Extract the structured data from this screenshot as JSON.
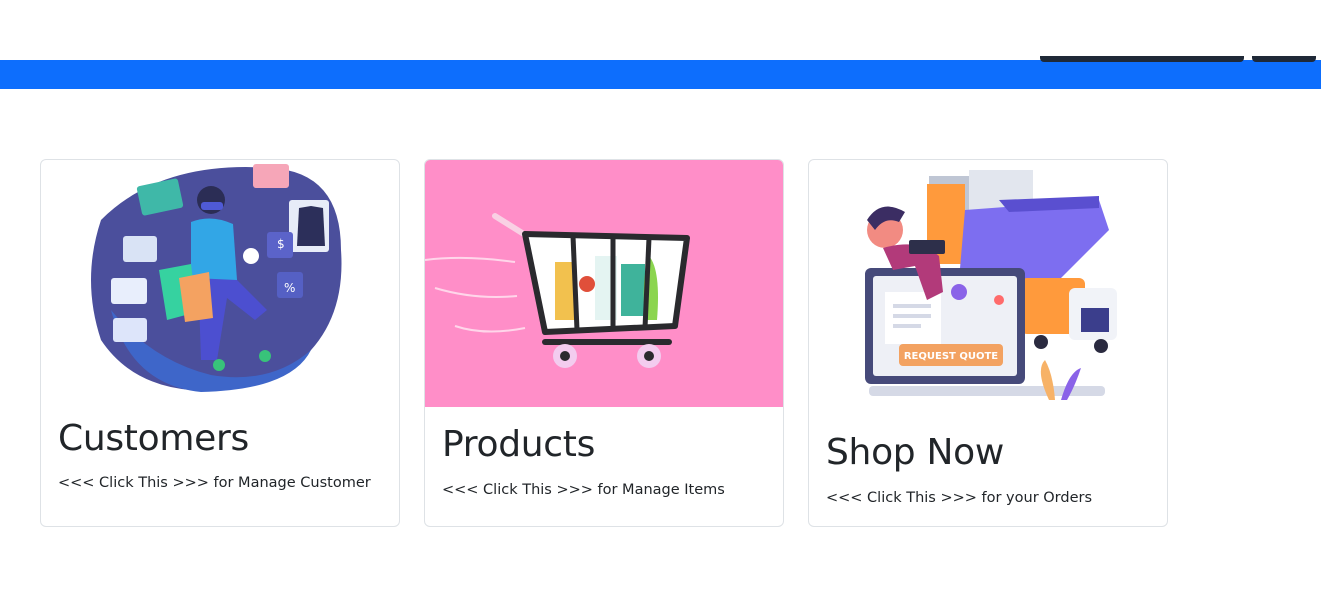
{
  "cards": [
    {
      "title": "Customers",
      "text": "<<< Click This >>> for Manage Customer",
      "image": "online-shopping-illustration"
    },
    {
      "title": "Products",
      "text": "<<< Click This >>> for Manage Items",
      "image": "shopping-cart-illustration",
      "bg": "#ff8ec8"
    },
    {
      "title": "Shop Now",
      "text": "<<< Click This >>> for your Orders",
      "image": "delivery-illustration",
      "badge": "REQUEST QUOTE"
    }
  ],
  "colors": {
    "navbar": "#0d6efd",
    "products_bg": "#ff8ec8"
  }
}
